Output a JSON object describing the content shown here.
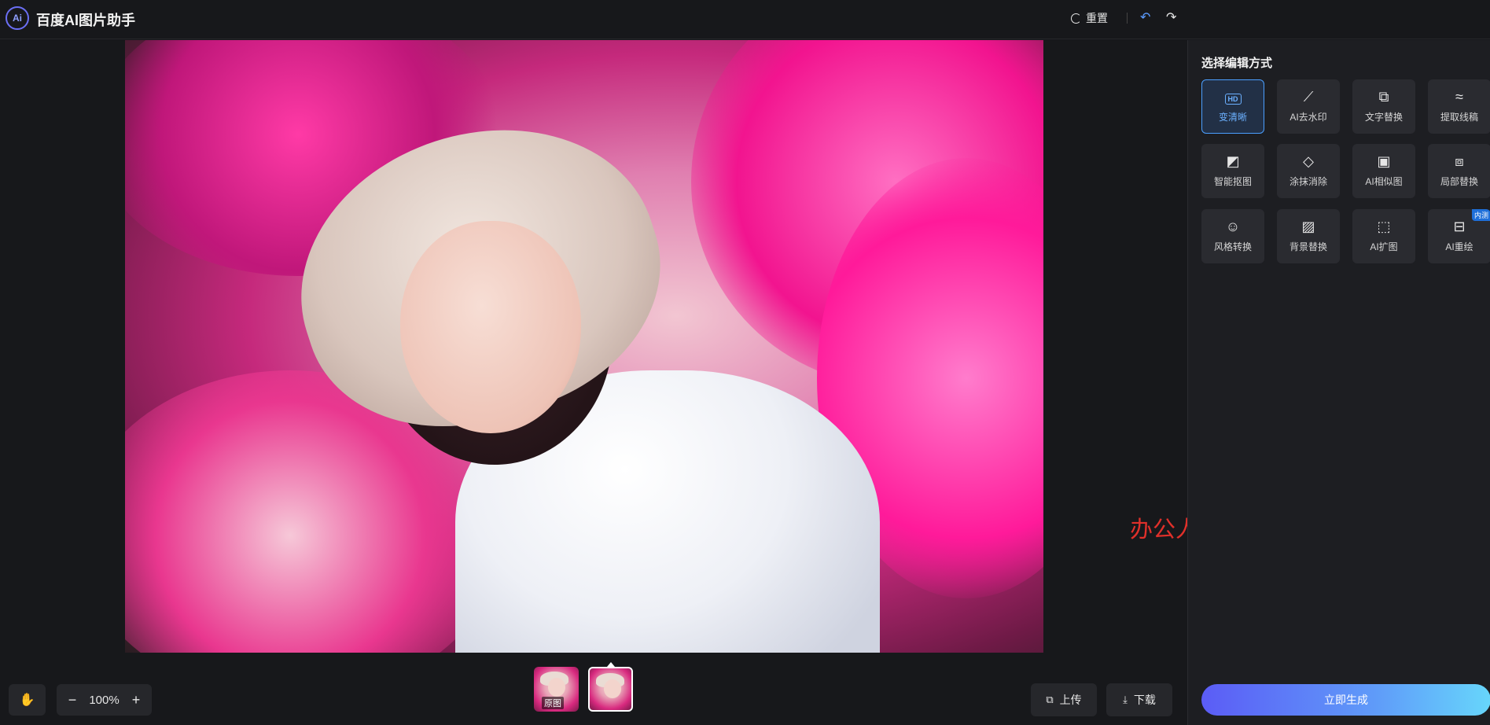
{
  "app": {
    "logo_text": "Ai",
    "title": "百度AI图片助手"
  },
  "toolbar": {
    "reset_label": "重置",
    "undo_icon": "undo-icon",
    "redo_icon": "redo-icon"
  },
  "canvas": {
    "watermark_text": "办公人导航 www.bgrdh.com"
  },
  "controls": {
    "zoom_level": "100%",
    "zoom_out": "−",
    "zoom_in": "+",
    "upload_label": "上传",
    "download_label": "下载"
  },
  "thumbnails": {
    "original_label": "原图"
  },
  "panel": {
    "title": "选择编辑方式",
    "tools": [
      {
        "label": "变清晰",
        "icon": "hd-icon",
        "active": true
      },
      {
        "label": "AI去水印",
        "icon": "magic-wand-icon"
      },
      {
        "label": "文字替换",
        "icon": "text-replace-icon"
      },
      {
        "label": "提取线稿",
        "icon": "line-art-icon"
      },
      {
        "label": "智能抠图",
        "icon": "cutout-icon"
      },
      {
        "label": "涂抹消除",
        "icon": "eraser-icon"
      },
      {
        "label": "AI相似图",
        "icon": "similar-image-icon"
      },
      {
        "label": "局部替换",
        "icon": "partial-replace-icon"
      },
      {
        "label": "风格转换",
        "icon": "style-icon"
      },
      {
        "label": "背景替换",
        "icon": "background-icon"
      },
      {
        "label": "AI扩图",
        "icon": "expand-icon"
      },
      {
        "label": "AI重绘",
        "icon": "repaint-icon",
        "badge": "内测"
      }
    ],
    "generate_label": "立即生成"
  },
  "colors": {
    "accent": "#4b9fff",
    "watermark": "#e0302a",
    "generate_gradient_start": "#5b5cf6",
    "generate_gradient_end": "#67d6fb"
  }
}
